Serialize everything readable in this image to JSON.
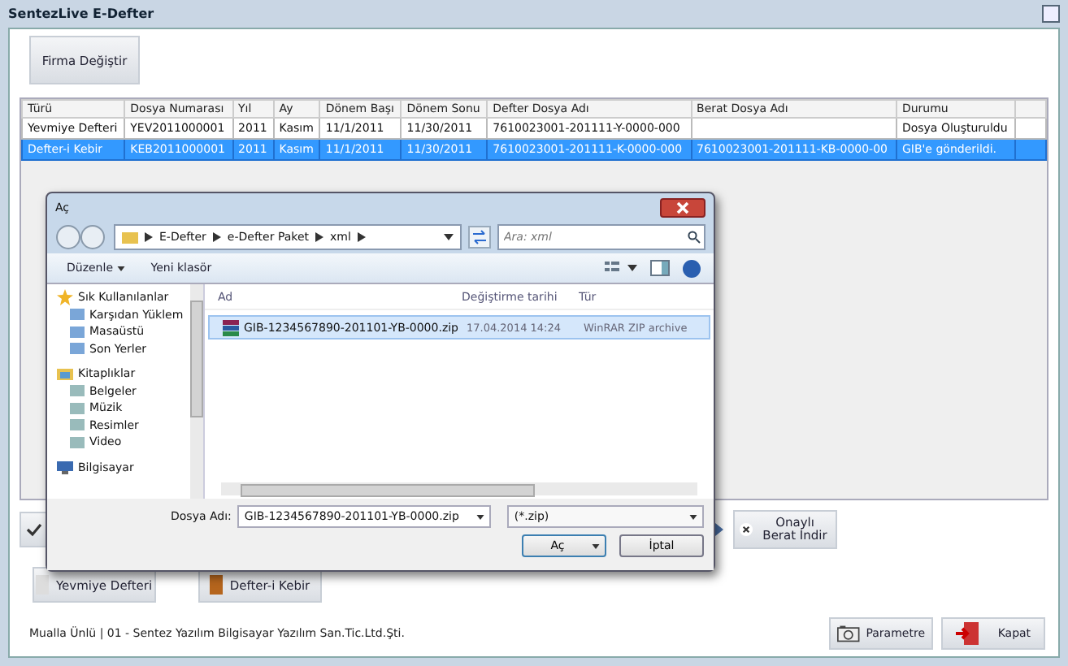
{
  "window": {
    "title": "SentezLive E-Defter"
  },
  "top_button": "Firma Değiştir",
  "table": {
    "columns": [
      "Türü",
      "Dosya Numarası",
      "Yıl",
      "Ay",
      "Dönem Başı",
      "Dönem Sonu",
      "Defter Dosya Adı",
      "Berat Dosya Adı",
      "Durumu"
    ],
    "rows": [
      {
        "selected": false,
        "cells": [
          "Yevmiye Defteri",
          "YEV2011000001",
          "2011",
          "Kasım",
          "11/1/2011",
          "11/30/2011",
          "7610023001-201111-Y-0000-000",
          "",
          "Dosya Oluşturuldu"
        ]
      },
      {
        "selected": true,
        "cells": [
          "Defter-i Kebir",
          "KEB2011000001",
          "2011",
          "Kasım",
          "11/1/2011",
          "11/30/2011",
          "7610023001-201111-K-0000-000",
          "7610023001-201111-KB-0000-00",
          "GIB'e gönderildi."
        ]
      }
    ]
  },
  "berat_button": "Onaylı Berat İndir",
  "book_buttons": [
    "Yevmiye Defteri",
    "Defter-i Kebir"
  ],
  "status_bar": {
    "text": "Mualla Ünlü | 01 - Sentez Yazılım Bilgisayar Yazılım San.Tic.Ltd.Şti.",
    "buttons": [
      "Parametre",
      "Kapat"
    ]
  },
  "dialog": {
    "title": "Aç",
    "breadcrumb": [
      "E-Defter",
      "e-Defter Paket",
      "xml"
    ],
    "search": {
      "placeholder": "Ara: xml"
    },
    "toolbar": [
      "Düzenle",
      "Yeni klasör"
    ],
    "nav": [
      {
        "label": "Sık Kullanılanlar",
        "kind": "favorites",
        "children": [
          {
            "label": "Karşıdan Yüklem"
          },
          {
            "label": "Masaüstü"
          },
          {
            "label": "Son Yerler"
          }
        ]
      },
      {
        "label": "Kitaplıklar",
        "kind": "libraries",
        "children": [
          {
            "label": "Belgeler"
          },
          {
            "label": "Müzik"
          },
          {
            "label": "Resimler"
          },
          {
            "label": "Video"
          }
        ]
      },
      {
        "label": "Bilgisayar",
        "kind": "computer"
      }
    ],
    "columns": [
      "Ad",
      "Değiştirme tarihi",
      "Tür"
    ],
    "files": [
      {
        "name": "GIB-1234567890-201101-YB-0000.zip",
        "date": "17.04.2014 14:24",
        "type": "WinRAR ZIP archive",
        "selected": true
      }
    ],
    "filename_label": "Dosya Adı:",
    "filename": "GIB-1234567890-201101-YB-0000.zip",
    "filter": "(*.zip)",
    "open": "Aç",
    "cancel": "İptal"
  }
}
